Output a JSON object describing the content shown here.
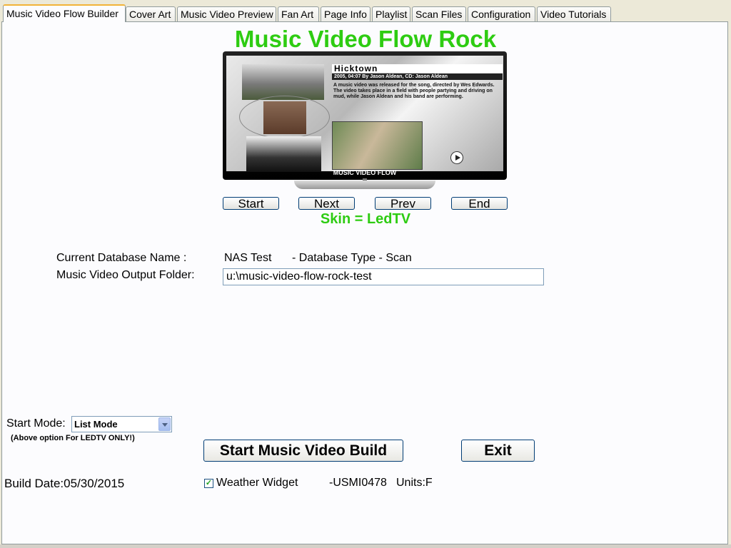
{
  "tabs": [
    {
      "label": "Music Video Flow Builder",
      "active": true
    },
    {
      "label": "Cover Art"
    },
    {
      "label": "Music Video Preview"
    },
    {
      "label": "Fan Art"
    },
    {
      "label": "Page Info"
    },
    {
      "label": "Playlist"
    },
    {
      "label": "Scan Files"
    },
    {
      "label": "Configuration"
    },
    {
      "label": "Video Tutorials"
    }
  ],
  "header": {
    "title": "Music Video Flow Rock"
  },
  "preview": {
    "song_title": "Hicktown",
    "subtitle": "2005, 04:07 By Jason Aldean, CD: Jason Aldean",
    "description": "A music video was released for the song, directed by Wes Edwards. The video takes place in a field with people partying and driving on mud, while Jason Aldean and his band are performing.",
    "brand": "MUSIC VIDEO FLOW"
  },
  "nav": {
    "start": "Start",
    "next": "Next",
    "prev": "Prev",
    "end": "End"
  },
  "skin": "Skin = LedTV",
  "database": {
    "name_label": "Current Database Name :",
    "name_value": "NAS Test",
    "type_text": "- Database Type - Scan",
    "output_label": "Music Video Output Folder:",
    "output_value": "u:\\music-video-flow-rock-test"
  },
  "start_mode": {
    "label": "Start Mode:",
    "value": "List Mode",
    "note": "(Above option For LEDTV ONLY!)"
  },
  "buttons": {
    "build": "Start Music Video Build",
    "exit": "Exit"
  },
  "footer": {
    "build_date": "Build Date:05/30/2015",
    "weather_label": "Weather Widget",
    "weather_checked": true,
    "location": "-USMI0478",
    "units": "Units:F"
  },
  "colors": {
    "accent_green": "#2ecc12",
    "tab_highlight": "#f2b337",
    "panel_bg": "#fcfcfe"
  }
}
